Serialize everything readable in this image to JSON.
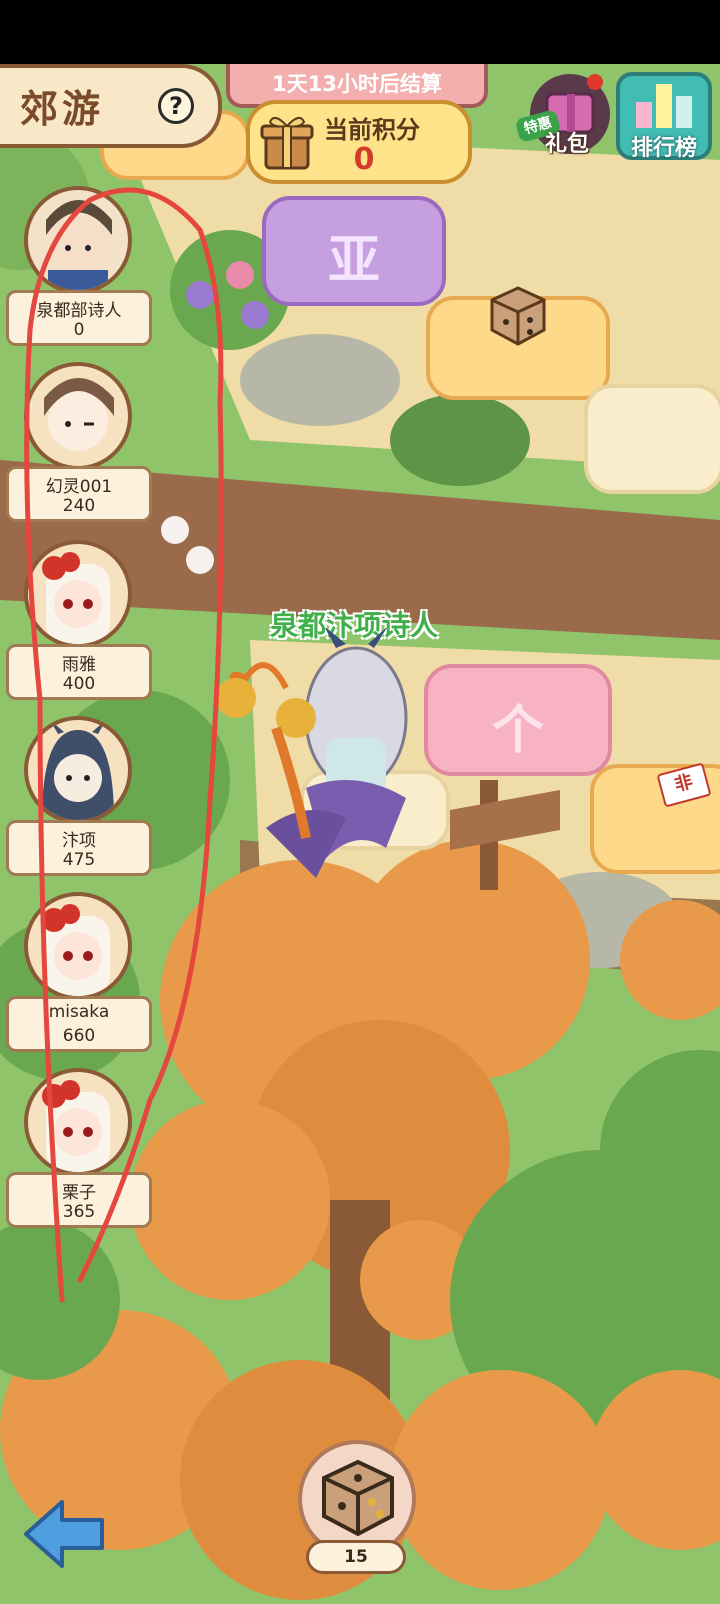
{
  "header": {
    "location_title": "郊游",
    "help_icon": "?",
    "timer_text": "1天13小时后结算",
    "score_label": "当前积分",
    "score_value": "0",
    "gift_pack_label": "礼包",
    "gift_pack_tag": "特惠",
    "leaderboard_label": "排行榜"
  },
  "players": [
    {
      "name": "泉都部诗人",
      "score": "0"
    },
    {
      "name": "幻灵001",
      "score": "240"
    },
    {
      "name": "雨雅",
      "score": "400"
    },
    {
      "name": "汴项",
      "score": "475"
    },
    {
      "name": "misaka",
      "score": "660"
    },
    {
      "name": "栗子",
      "score": "365"
    }
  ],
  "board": {
    "token_name": "泉都汴项诗人",
    "tile_glyph_purple": "亚",
    "tile_glyph_pink": "个",
    "tag_label": "非"
  },
  "footer": {
    "dice_count": "15",
    "back_icon": "left-arrow-icon"
  },
  "colors": {
    "grass": "#8fc46a",
    "path": "#f3e2b3",
    "annotation_stroke": "#e5473f",
    "autumn_tree": "#e89a4a"
  }
}
